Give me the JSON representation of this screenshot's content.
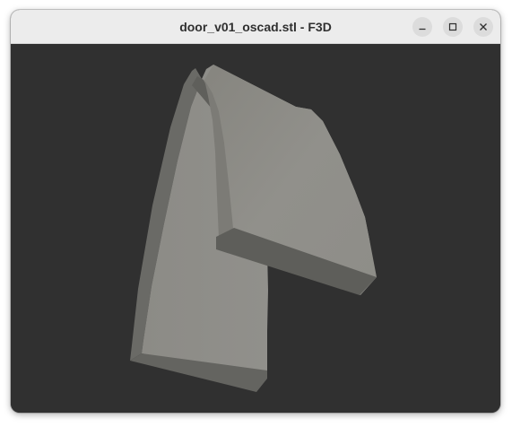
{
  "window": {
    "title": "door_v01_oscad.stl - F3D",
    "controls": {
      "minimize": "minimize-icon",
      "maximize": "maximize-icon",
      "close": "close-icon"
    }
  },
  "viewport": {
    "background_color": "#303030",
    "model_color": "#8f8e89"
  }
}
